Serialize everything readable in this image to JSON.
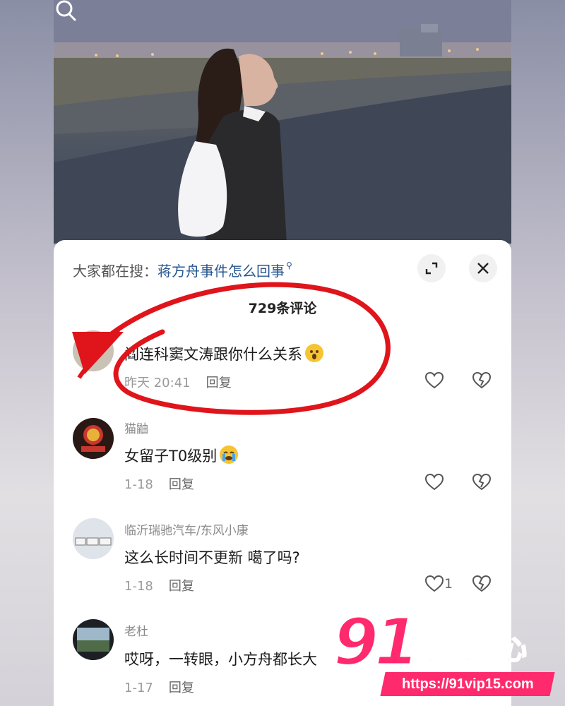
{
  "search": {
    "prefix": "大家都在搜：",
    "query": "蒋方舟事件怎么回事",
    "icon": "search-icon"
  },
  "comments_count": "729条评论",
  "comments": [
    {
      "username": "",
      "text": "阎连科窦文涛跟你什么关系",
      "emoji": "surprised-face-emoji",
      "time": "昨天 20:41",
      "reply": "回复",
      "likes": ""
    },
    {
      "username": "猫鼬",
      "text": "女留子T0级别",
      "emoji": "crying-face-emoji",
      "time": "1-18",
      "reply": "回复",
      "likes": ""
    },
    {
      "username": "临沂瑞驰汽车/东风小康",
      "text": "这么长时间不更新  噶了吗?",
      "time": "1-18",
      "reply": "回复",
      "likes": "1"
    },
    {
      "username": "老杜",
      "text": "哎呀，一转眼，小方舟都长大",
      "time": "1-17",
      "reply": "回复",
      "likes": ""
    }
  ],
  "watermark": {
    "number": "91",
    "title": "吃瓜中心",
    "url": "https://91vip15.com"
  },
  "colors": {
    "accent_red": "#e0141b",
    "watermark_pink": "#ff2a6d",
    "link_blue": "#27568f"
  }
}
